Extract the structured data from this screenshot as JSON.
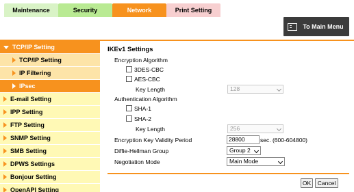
{
  "tabs": [
    {
      "label": "Maintenance"
    },
    {
      "label": "Security"
    },
    {
      "label": "Network"
    },
    {
      "label": "Print Setting"
    }
  ],
  "main_menu": {
    "label": "To Main Menu"
  },
  "sidebar": {
    "top": {
      "label": "TCP/IP Setting"
    },
    "subitems": [
      {
        "label": "TCP/IP Setting"
      },
      {
        "label": "IP Filtering"
      },
      {
        "label": "IPsec"
      }
    ],
    "items": [
      {
        "label": "E-mail Setting"
      },
      {
        "label": "IPP Setting"
      },
      {
        "label": "FTP Setting"
      },
      {
        "label": "SNMP Setting"
      },
      {
        "label": "SMB Setting"
      },
      {
        "label": "DPWS Settings"
      },
      {
        "label": "Bonjour Setting"
      },
      {
        "label": "OpenAPI Setting"
      }
    ]
  },
  "main": {
    "title": "IKEv1 Settings",
    "encryption_algorithm": "Encryption Algorithm",
    "opt_3des": "3DES-CBC",
    "opt_aes": "AES-CBC",
    "key_length_label": "Key Length",
    "aes_key_length": "128",
    "authentication_algorithm": "Authentication Algorithm",
    "opt_sha1": "SHA-1",
    "opt_sha2": "SHA-2",
    "sha_key_length": "256",
    "validity_label": "Encryption Key Validity Period",
    "validity_value": "28800",
    "validity_unit": "sec. (600-604800)",
    "dh_label": "Diffie-Hellman Group",
    "dh_value": "Group 2",
    "neg_label": "Negotiation Mode",
    "neg_value": "Main Mode"
  },
  "buttons": {
    "ok": "OK",
    "cancel": "Cancel"
  }
}
